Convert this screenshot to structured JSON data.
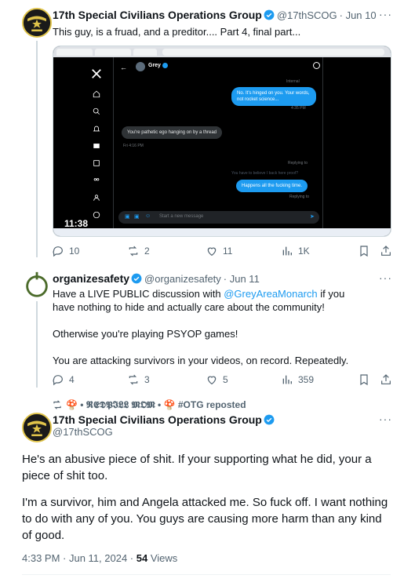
{
  "tweet1": {
    "name": "17th Special Civilians Operations Group",
    "handle": "@17thSCOG",
    "date": "· Jun 10",
    "text": "This guy, is a fruad, and a preditor.... Part 4, final part...",
    "screenshot": {
      "dm_name": "Grey",
      "msg_internal": "Internal",
      "msg_blue_1": "No. It's hinged on you. Your words, not rocket science...",
      "msg_time_1": "4:35 PM",
      "msg_grey": "You're pathetic ego hanging on by a thread",
      "msg_time_2": "Fri 4:16 PM",
      "msg_reply_to": "Replying to",
      "msg_faded": "You have to believe I back here proof?",
      "msg_blue_2": "Happens all the fucking time.",
      "msg_replying": "Replying to",
      "composer_placeholder": "Start a new message",
      "clock": "11:38"
    },
    "stats": {
      "replies": "10",
      "reposts": "2",
      "likes": "11",
      "views": "1K"
    }
  },
  "tweet2": {
    "name": "organizesafety",
    "handle": "@organizesafety",
    "date": "· Jun 11",
    "text_before": "Have a LIVE PUBLIC discussion with ",
    "mention": "@GreyAreaMonarch",
    "text_after": " if you have nothing to hide and actually care about the community!",
    "para2": "Otherwise you're playing PSYOP games!",
    "para3": "You are attacking survivors in your videos, on record. Repeatedly.",
    "stats": {
      "replies": "4",
      "reposts": "3",
      "likes": "5",
      "views": "359"
    }
  },
  "repost_line": "🍄 • 𝕽𝕰𝕯𝕻𝕴𝕷𝕷 𝕸𝕺𝕸 • 🍄 #OTG reposted",
  "tweet3": {
    "name": "17th Special Civilians Operations Group",
    "handle": "@17thSCOG",
    "para1": "He's an abusive piece of shit. If your supporting what he did, your a piece of shit too.",
    "para2": "I'm a survivor, him and Angela attacked me. So fuck off. I want nothing to do with any of you. You guys are causing more harm than any kind of good.",
    "timestamp": "4:33 PM · Jun 11, 2024 · ",
    "views_count": "54",
    "views_label": " Views"
  },
  "more_label": "···",
  "colors": {
    "accent": "#1d9bf0",
    "text": "#0f1419",
    "muted": "#536471",
    "divider": "#eff3f4"
  }
}
